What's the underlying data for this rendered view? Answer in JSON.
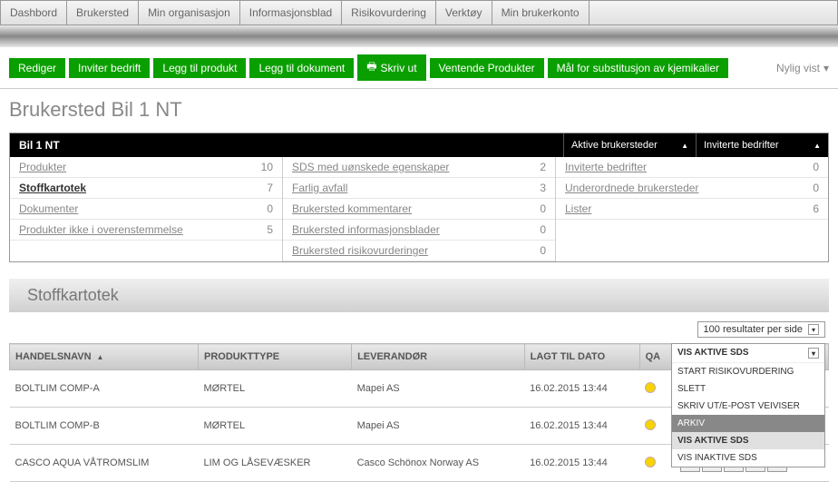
{
  "topnav": [
    "Dashbord",
    "Brukersted",
    "Min organisasjon",
    "Informasjonsblad",
    "Risikovurdering",
    "Verktøy",
    "Min brukerkonto"
  ],
  "actions": {
    "rediger": "Rediger",
    "inviter": "Inviter bedrift",
    "legg_produkt": "Legg til produkt",
    "legg_dokument": "Legg til dokument",
    "skriv_ut": "Skriv ut",
    "ventende": "Ventende Produkter",
    "mal": "Mål for substitusjon av kjemikalier"
  },
  "nylig_vist": "Nylig vist",
  "page_title": "Brukersted Bil 1 NT",
  "panel": {
    "title": "Bil 1 NT",
    "dd1": "Aktive brukersteder",
    "dd2": "Inviterte bedrifter"
  },
  "stats": {
    "col1": [
      {
        "label": "Produkter",
        "value": "10",
        "bold": false
      },
      {
        "label": "Stoffkartotek",
        "value": "7",
        "bold": true
      },
      {
        "label": "Dokumenter",
        "value": "0",
        "bold": false
      },
      {
        "label": "Produkter ikke i overenstemmelse",
        "value": "5",
        "bold": false
      }
    ],
    "col2": [
      {
        "label": "SDS med uønskede egenskaper",
        "value": "2"
      },
      {
        "label": "Farlig avfall",
        "value": "3"
      },
      {
        "label": "Brukersted kommentarer",
        "value": "0"
      },
      {
        "label": "Brukersted informasjonsblader",
        "value": "0"
      },
      {
        "label": "Brukersted risikovurderinger",
        "value": "0"
      }
    ],
    "col3": [
      {
        "label": "Inviterte bedrifter",
        "value": "0"
      },
      {
        "label": "Underordnede brukersteder",
        "value": "0"
      },
      {
        "label": "Lister",
        "value": "6"
      }
    ]
  },
  "section_title": "Stoffkartotek",
  "results_per_page": "100 resultater per side",
  "columns": {
    "handelsnavn": "HANDELSNAVN",
    "produkttype": "PRODUKTTYPE",
    "leverandor": "LEVERANDØR",
    "lagt_til": "LAGT TIL DATO",
    "qa": "QA"
  },
  "rows": [
    {
      "navn": "BOLTLIM COMP-A",
      "type": "MØRTEL",
      "lev": "Mapei AS",
      "dato": "16.02.2015 13:44"
    },
    {
      "navn": "BOLTLIM COMP-B",
      "type": "MØRTEL",
      "lev": "Mapei AS",
      "dato": "16.02.2015 13:44"
    },
    {
      "navn": "CASCO AQUA VÅTROMSLIM",
      "type": "LIM OG LÅSEVÆSKER",
      "lev": "Casco Schönox Norway AS",
      "dato": "16.02.2015 13:44"
    }
  ],
  "menu": {
    "header": "VIS AKTIVE SDS",
    "items": [
      "START RISIKOVURDERING",
      "SLETT",
      "SKRIV UT/E-POST VEIVISER",
      "ARKIV"
    ],
    "footer": [
      "VIS AKTIVE SDS",
      "VIS INAKTIVE SDS"
    ]
  }
}
